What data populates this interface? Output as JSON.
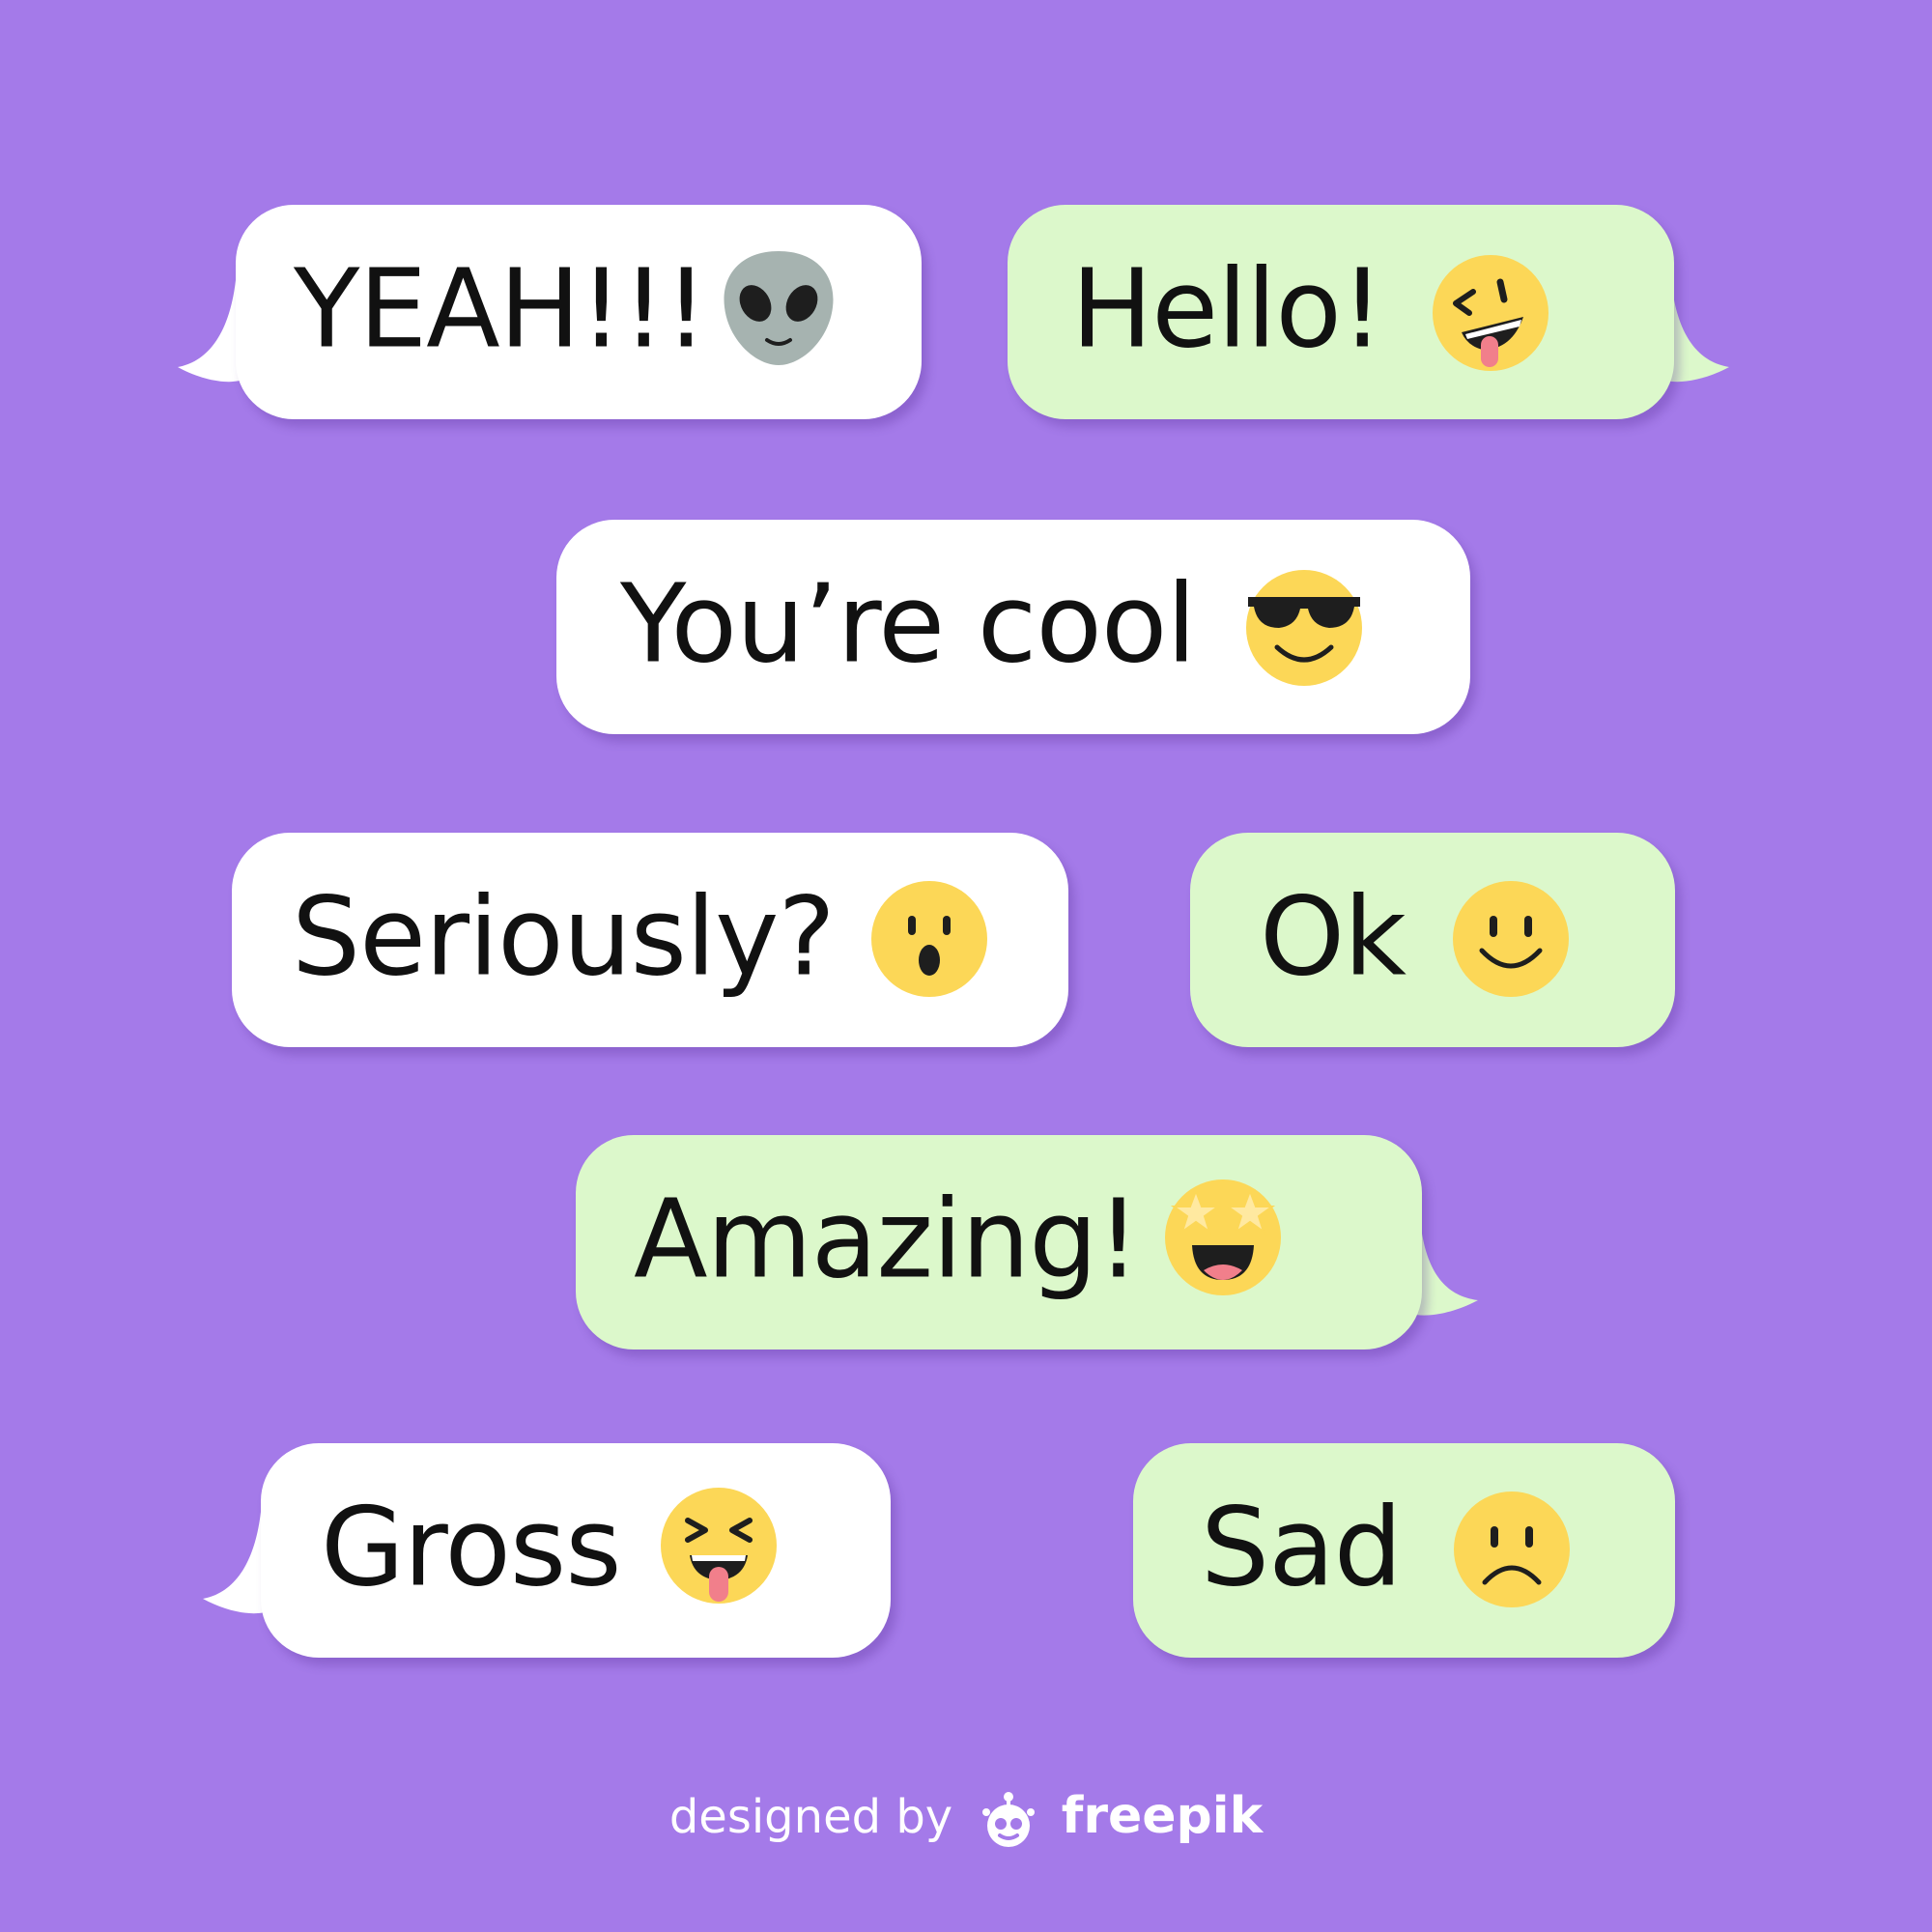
{
  "colors": {
    "background": "#a47ae9",
    "bubble_white": "#ffffff",
    "bubble_green": "#dcf8cb",
    "emoji_yellow": "#fcd757",
    "alien_gray": "#a6b3b0",
    "text": "#111111"
  },
  "messages": [
    {
      "text": "YEAH!!!",
      "bubble": "white",
      "tail": "left",
      "emoji": "alien-icon"
    },
    {
      "text": "Hello!",
      "bubble": "green",
      "tail": "right",
      "emoji": "winking-tongue-face-icon"
    },
    {
      "text": "You’re cool",
      "bubble": "white",
      "tail": "none",
      "emoji": "sunglasses-face-icon"
    },
    {
      "text": "Seriously?",
      "bubble": "white",
      "tail": "none",
      "emoji": "surprised-face-icon"
    },
    {
      "text": "Ok",
      "bubble": "green",
      "tail": "none",
      "emoji": "smiling-face-icon"
    },
    {
      "text": "Amazing!",
      "bubble": "green",
      "tail": "right",
      "emoji": "star-eyes-face-icon"
    },
    {
      "text": "Gross",
      "bubble": "white",
      "tail": "left",
      "emoji": "squinting-tongue-face-icon"
    },
    {
      "text": "Sad",
      "bubble": "green",
      "tail": "none",
      "emoji": "frowning-face-icon"
    }
  ],
  "footer": {
    "prefix": "designed by",
    "brand": "freepik",
    "logo": "freepik-logo-icon"
  }
}
